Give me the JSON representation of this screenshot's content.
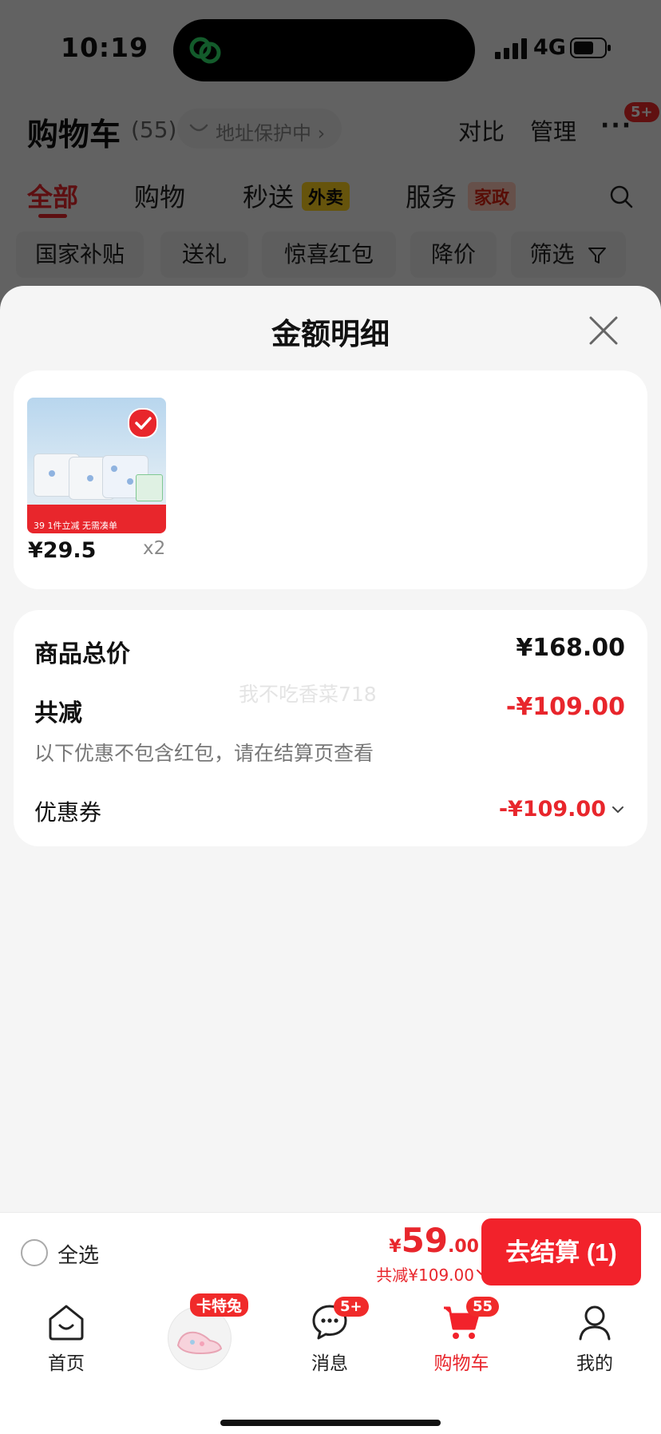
{
  "status_bar": {
    "time": "10:19",
    "network": "4G"
  },
  "header": {
    "title": "购物车",
    "count": "(55)",
    "address_protection": "地址保护中 ›",
    "compare": "对比",
    "manage": "管理",
    "more_badge": "5+"
  },
  "tabs": [
    {
      "label": "全部"
    },
    {
      "label": "购物"
    },
    {
      "label": "秒送",
      "tag": "外卖"
    },
    {
      "label": "服务",
      "tag": "家政"
    }
  ],
  "filter_chips": [
    "国家补贴",
    "送礼",
    "惊喜红包",
    "降价",
    "筛选"
  ],
  "sheet": {
    "title": "金额明细",
    "product": {
      "price": "¥29.5",
      "quantity": "x2",
      "banner_text": "39   1件立减 无需凑单"
    },
    "summary": {
      "total_label": "商品总价",
      "total_value": "¥168.00",
      "discount_label": "共减",
      "discount_value": "-¥109.00",
      "note": "以下优惠不包含红包，请在结算页查看",
      "coupon_label": "优惠券",
      "coupon_value": "-¥109.00"
    },
    "watermark": "我不吃香菜718"
  },
  "checkout": {
    "select_all": "全选",
    "price_symbol": "¥",
    "price_integer": "59",
    "price_decimal": ".00",
    "saved": "共减¥109.00",
    "button": "去结算 (1)"
  },
  "tabbar": {
    "home": "首页",
    "promo_tag": "卡特兔",
    "messages": "消息",
    "messages_badge": "5+",
    "cart": "购物车",
    "cart_badge": "55",
    "me": "我的"
  },
  "colors": {
    "accent": "#e8262c",
    "checkout_button": "#f2222b",
    "overlay": "rgba(0,0,0,0.6)"
  }
}
